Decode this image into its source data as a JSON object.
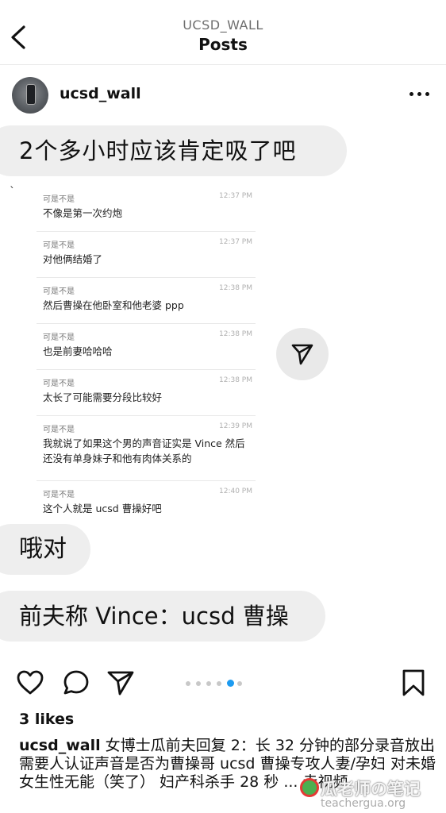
{
  "header": {
    "account": "UCSD_WALL",
    "title": "Posts"
  },
  "post": {
    "author": "ucsd_wall",
    "bubbles": [
      "2个多小时应该肯定吸了吧",
      "哦对",
      "前夫称 Vince：ucsd 曹操"
    ],
    "stray_mark": "`",
    "messages": [
      {
        "sender": "可是不是",
        "time": "12:37 PM",
        "text": "不像是第一次约炮"
      },
      {
        "sender": "可是不是",
        "time": "12:37 PM",
        "text": "对他俩结婚了"
      },
      {
        "sender": "可是不是",
        "time": "12:38 PM",
        "text": "然后曹操在他卧室和他老婆 ppp"
      },
      {
        "sender": "可是不是",
        "time": "12:38 PM",
        "text": "也是前妻哈哈哈"
      },
      {
        "sender": "可是不是",
        "time": "12:38 PM",
        "text": "太长了可能需要分段比较好"
      },
      {
        "sender": "可是不是",
        "time": "12:39 PM",
        "text": "我就说了如果这个男的声音证实是 Vince 然后还没有单身妹子和他有肉体关系的"
      },
      {
        "sender": "可是不是",
        "time": "12:40 PM",
        "text": "这个人就是 ucsd 曹操好吧"
      }
    ],
    "carousel": {
      "count": 6,
      "active_index": 4
    }
  },
  "engagement": {
    "likes": "3 likes",
    "caption_author": "ucsd_wall",
    "caption_text": " 女博士瓜前夫回复 2：长 32 分钟的部分录音放出 需要人认证声音是否为曹操哥 ucsd 曹操专攻人妻/孕妇 对未婚女生性无能（笑了） 妇产科杀手 28 秒 ... 走视频"
  },
  "watermark": {
    "cn": "瓜老师の笔记",
    "en": "teachergua.org"
  },
  "colors": {
    "accent": "#1d9bf0",
    "bubble_bg": "#eeeeee"
  },
  "icons": [
    "back-arrow-icon",
    "more-icon",
    "send-icon",
    "heart-icon",
    "comment-icon",
    "share-icon",
    "bookmark-icon"
  ]
}
